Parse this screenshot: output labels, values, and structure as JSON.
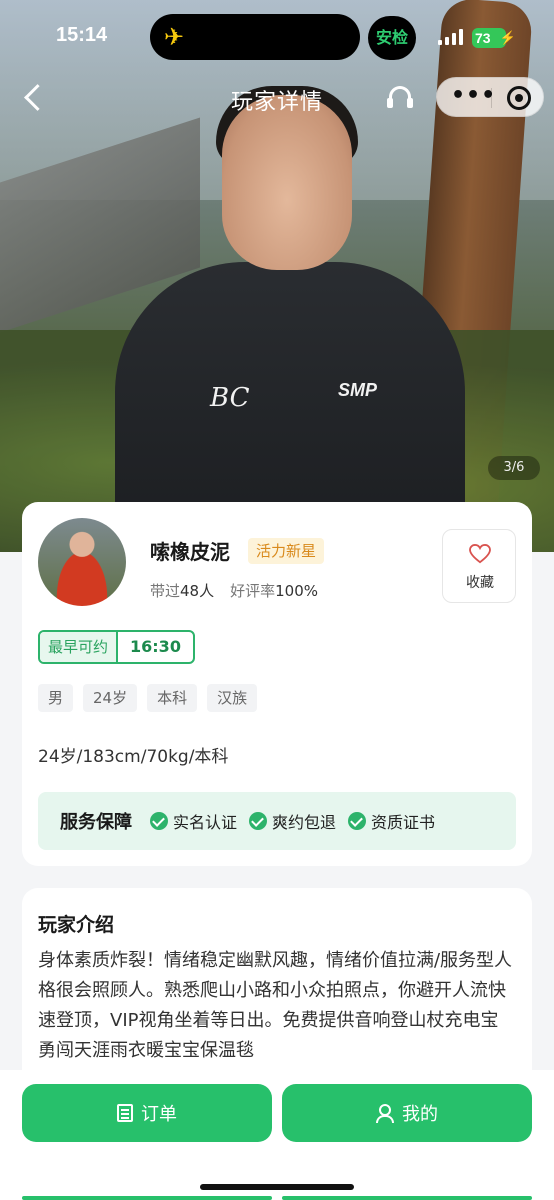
{
  "status_bar": {
    "time": "15:14",
    "guard_label": "安检",
    "battery": "73",
    "icons": [
      "airplane-icon",
      "signal-icon",
      "battery-icon"
    ]
  },
  "nav": {
    "title": "玩家详情",
    "icons": [
      "back-icon",
      "headset-icon",
      "more-icon",
      "target-icon"
    ]
  },
  "hero": {
    "photo_counter": "3/6",
    "logo_left": "BC",
    "logo_right": "SMP"
  },
  "profile": {
    "name": "嗦橡皮泥",
    "rank_badge": "活力新星",
    "served_label": "带过",
    "served_value": "48人",
    "rating_label": "好评率",
    "rating_value": "100%",
    "favorite_label": "收藏",
    "earliest_label": "最早可约",
    "earliest_time": "16:30",
    "tags": [
      "男",
      "24岁",
      "本科",
      "汉族"
    ],
    "info_line": "24岁/183cm/70kg/本科",
    "service": {
      "title": "服务保障",
      "items": [
        "实名认证",
        "爽约包退",
        "资质证书"
      ]
    }
  },
  "intro": {
    "title": "玩家介绍",
    "text": "身体素质炸裂！情绪稳定幽默风趣，情绪价值拉满/服务型人格很会照顾人。熟悉爬山小路和小众拍照点，你避开人流快速登顶，VIP视角坐着等日出。免费提供音响登山杖充电宝勇闯天涯雨衣暖宝宝保温毯"
  },
  "bottom": {
    "orders_label": "订单",
    "mine_label": "我的"
  },
  "colors": {
    "accent": "#27c06b",
    "badge_bg": "#fdf3d9",
    "badge_text": "#d98a1c",
    "service_bg": "#e6f6ee",
    "heart": "#d9534f"
  }
}
